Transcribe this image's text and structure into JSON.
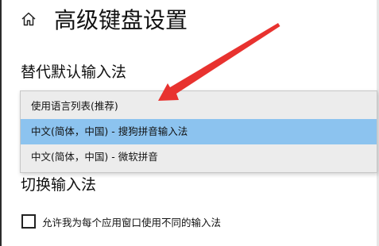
{
  "header": {
    "title": "高级键盘设置",
    "home_icon": "home-icon"
  },
  "override_section": {
    "title": "替代默认输入法",
    "dropdown": {
      "expanded": true,
      "selected_index": 1,
      "options": [
        "使用语言列表(推荐)",
        "中文(简体，中国) - 搜狗拼音输入法",
        "中文(简体，中国) - 微软拼音"
      ]
    }
  },
  "switch_section": {
    "title": "切换输入法",
    "checkbox": {
      "checked": false,
      "label": "允许我为每个应用窗口使用不同的输入法"
    }
  },
  "annotation": {
    "arrow_color": "#e8322f"
  },
  "colors": {
    "highlight": "#8cc3ef",
    "dropdown_bg": "#ececec",
    "text": "#111111"
  }
}
